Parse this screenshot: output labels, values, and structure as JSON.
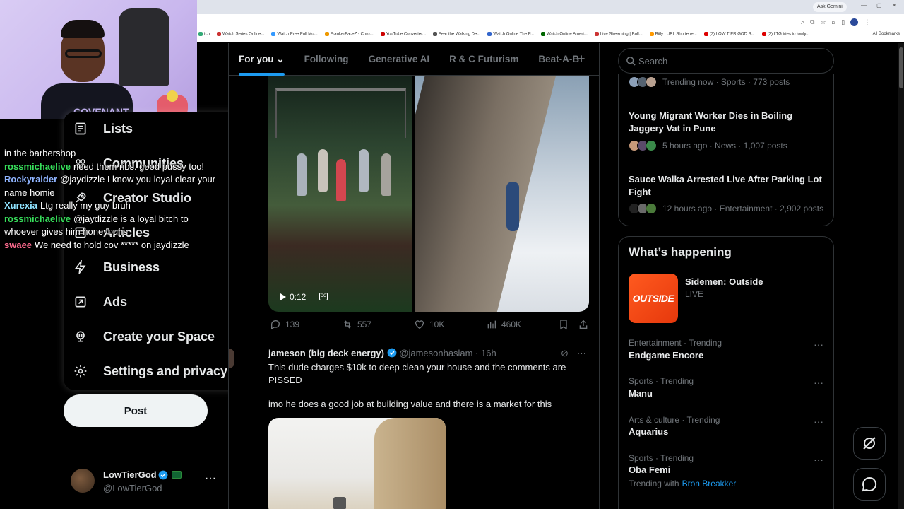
{
  "browser": {
    "ask_gemini": "Ask Gemini",
    "bookmarks": [
      "tch",
      "Watch Series Online...",
      "Watch Free Full Mo...",
      "FrankerFaceZ - Chro...",
      "YouTube Converter...",
      "Fear the Walking De...",
      "Watch Online The P...",
      "Watch Online Ameri...",
      "Live Streaming | Bull...",
      "Bitly | URL Shortene...",
      "(2) LOW TIER GOD S...",
      "(2) LTG tries to lowly..."
    ],
    "all_bookmarks": "All Bookmarks"
  },
  "webcam": {
    "shirt_text": "COVENANT"
  },
  "left_menu": {
    "items": [
      {
        "label": "Lists",
        "icon": "list-icon"
      },
      {
        "label": "Communities",
        "icon": "communities-icon"
      },
      {
        "label": "Creator Studio",
        "icon": "rocket-icon"
      },
      {
        "label": "Articles",
        "icon": "article-icon"
      },
      {
        "label": "Business",
        "icon": "lightning-icon"
      },
      {
        "label": "Ads",
        "icon": "ads-icon"
      },
      {
        "label": "Create your Space",
        "icon": "microphone-icon"
      },
      {
        "label": "Settings and privacy",
        "icon": "gear-icon"
      }
    ]
  },
  "chat": {
    "lines": [
      {
        "user": "",
        "color": "#ffffff",
        "text": "in the barbershop"
      },
      {
        "user": "rossmichaelive",
        "color": "#37e05b",
        "text": "need them ribs. good pussy too!"
      },
      {
        "user": "Rockyraider",
        "color": "#8fb4ff",
        "text": "@jaydizzle I know you loyal clear your"
      },
      {
        "user": "",
        "color": "#ffffff",
        "text": "name homie"
      },
      {
        "user": "Xurexia",
        "color": "#8fe3ff",
        "text": "Ltg really my guy bruh"
      },
      {
        "user": "rossmichaelive",
        "color": "#37e05b",
        "text": "@jaydizzle is a loyal bitch to"
      },
      {
        "user": "",
        "color": "#ffffff",
        "text": "whoever gives him honeybuns"
      },
      {
        "user": "swaee",
        "color": "#ff6b8f",
        "text": "We need to hold cov ***** on jaydizzle"
      }
    ]
  },
  "post_button": "Post",
  "account": {
    "name": "LowTierGod",
    "handle": "@LowTierGod",
    "more": "···"
  },
  "tabs": [
    {
      "label": "For you ⌄",
      "active": true
    },
    {
      "label": "Following",
      "active": false
    },
    {
      "label": "Generative AI",
      "active": false
    },
    {
      "label": "R & C Futurism",
      "active": false
    },
    {
      "label": "Beat-A-B",
      "active": false
    }
  ],
  "tab_add": "+",
  "video": {
    "duration": "0:12",
    "cc": "CC"
  },
  "post1_actions": {
    "replies": "139",
    "reposts": "557",
    "likes": "10K",
    "views": "460K"
  },
  "post2": {
    "name": "jameson (big deck energy)",
    "handle": "@jamesonhaslam",
    "time": "· 16h",
    "text1": "This dude charges $10k to deep clean your house and the comments are PISSED",
    "text2": "imo he does a good job at building value and there is a market for this"
  },
  "search": {
    "placeholder": "Search"
  },
  "trending": [
    {
      "meta": "Trending now · Sports · 773 posts",
      "title": ""
    },
    {
      "meta": "5 hours ago · News · 1,007 posts",
      "title": "Young Migrant Worker Dies in Boiling Jaggery Vat in Pune"
    },
    {
      "meta": "12 hours ago · Entertainment · 2,902 posts",
      "title": "Sauce Walka Arrested Live After Parking Lot Fight"
    }
  ],
  "happening": {
    "title": "What’s happening",
    "feature": {
      "thumb_text": "OUTSIDE",
      "title": "Sidemen: Outside",
      "status": "LIVE"
    },
    "items": [
      {
        "meta": "Entertainment · Trending",
        "name": "Endgame Encore"
      },
      {
        "meta": "Sports · Trending",
        "name": "Manu"
      },
      {
        "meta": "Arts & culture · Trending",
        "name": "Aquarius"
      },
      {
        "meta": "Sports · Trending",
        "name": "Oba Femi"
      }
    ],
    "more": "···",
    "trending_with": "Trending with",
    "trending_with_link": "Bron Breakker"
  },
  "colors": {
    "accent": "#1d9bf0",
    "background": "#000000",
    "border": "#2f3336",
    "muted": "#71767b"
  }
}
